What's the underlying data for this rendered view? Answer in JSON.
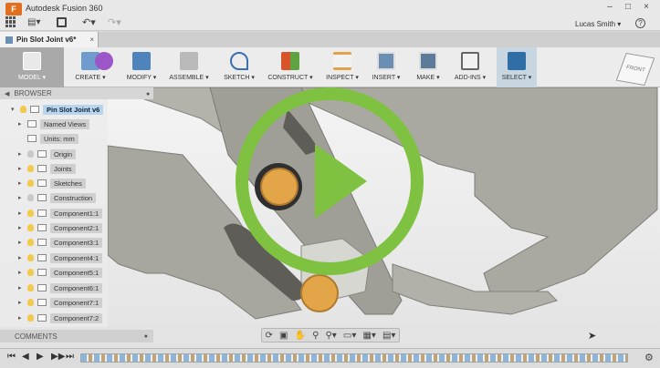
{
  "titlebar": {
    "app_title": "Autodesk Fusion 360",
    "user": "Lucas Smith ▾",
    "help": "?"
  },
  "document_tab": {
    "label": "Pin Slot Joint v6*",
    "close": "×"
  },
  "toolbar": {
    "workspace": "MODEL ▾",
    "tools": [
      {
        "label": "CREATE ▾"
      },
      {
        "label": "MODIFY ▾"
      },
      {
        "label": "ASSEMBLE ▾"
      },
      {
        "label": "SKETCH ▾"
      },
      {
        "label": "CONSTRUCT ▾"
      },
      {
        "label": "INSPECT ▾"
      },
      {
        "label": "INSERT ▾"
      },
      {
        "label": "MAKE ▾"
      },
      {
        "label": "ADD-INS ▾"
      },
      {
        "label": "SELECT ▾"
      }
    ]
  },
  "viewcube": {
    "label": "FRONT"
  },
  "browser": {
    "header": "BROWSER",
    "root": "Pin Slot Joint v6",
    "items": [
      {
        "label": "Named Views"
      },
      {
        "label": "Units: mm"
      },
      {
        "label": "Origin"
      },
      {
        "label": "Joints"
      },
      {
        "label": "Sketches"
      },
      {
        "label": "Construction"
      },
      {
        "label": "Component1:1"
      },
      {
        "label": "Component2:1"
      },
      {
        "label": "Component3:1"
      },
      {
        "label": "Component4:1"
      },
      {
        "label": "Component5:1"
      },
      {
        "label": "Component6:1"
      },
      {
        "label": "Component7:1"
      },
      {
        "label": "Component7:2"
      }
    ]
  },
  "comments": {
    "label": "COMMENTS"
  },
  "colors": {
    "play_overlay": "#7fc241",
    "part_gray": "#a4a39c",
    "pin_orange": "#e0a24a",
    "selection_blue": "#b9d5ee"
  }
}
